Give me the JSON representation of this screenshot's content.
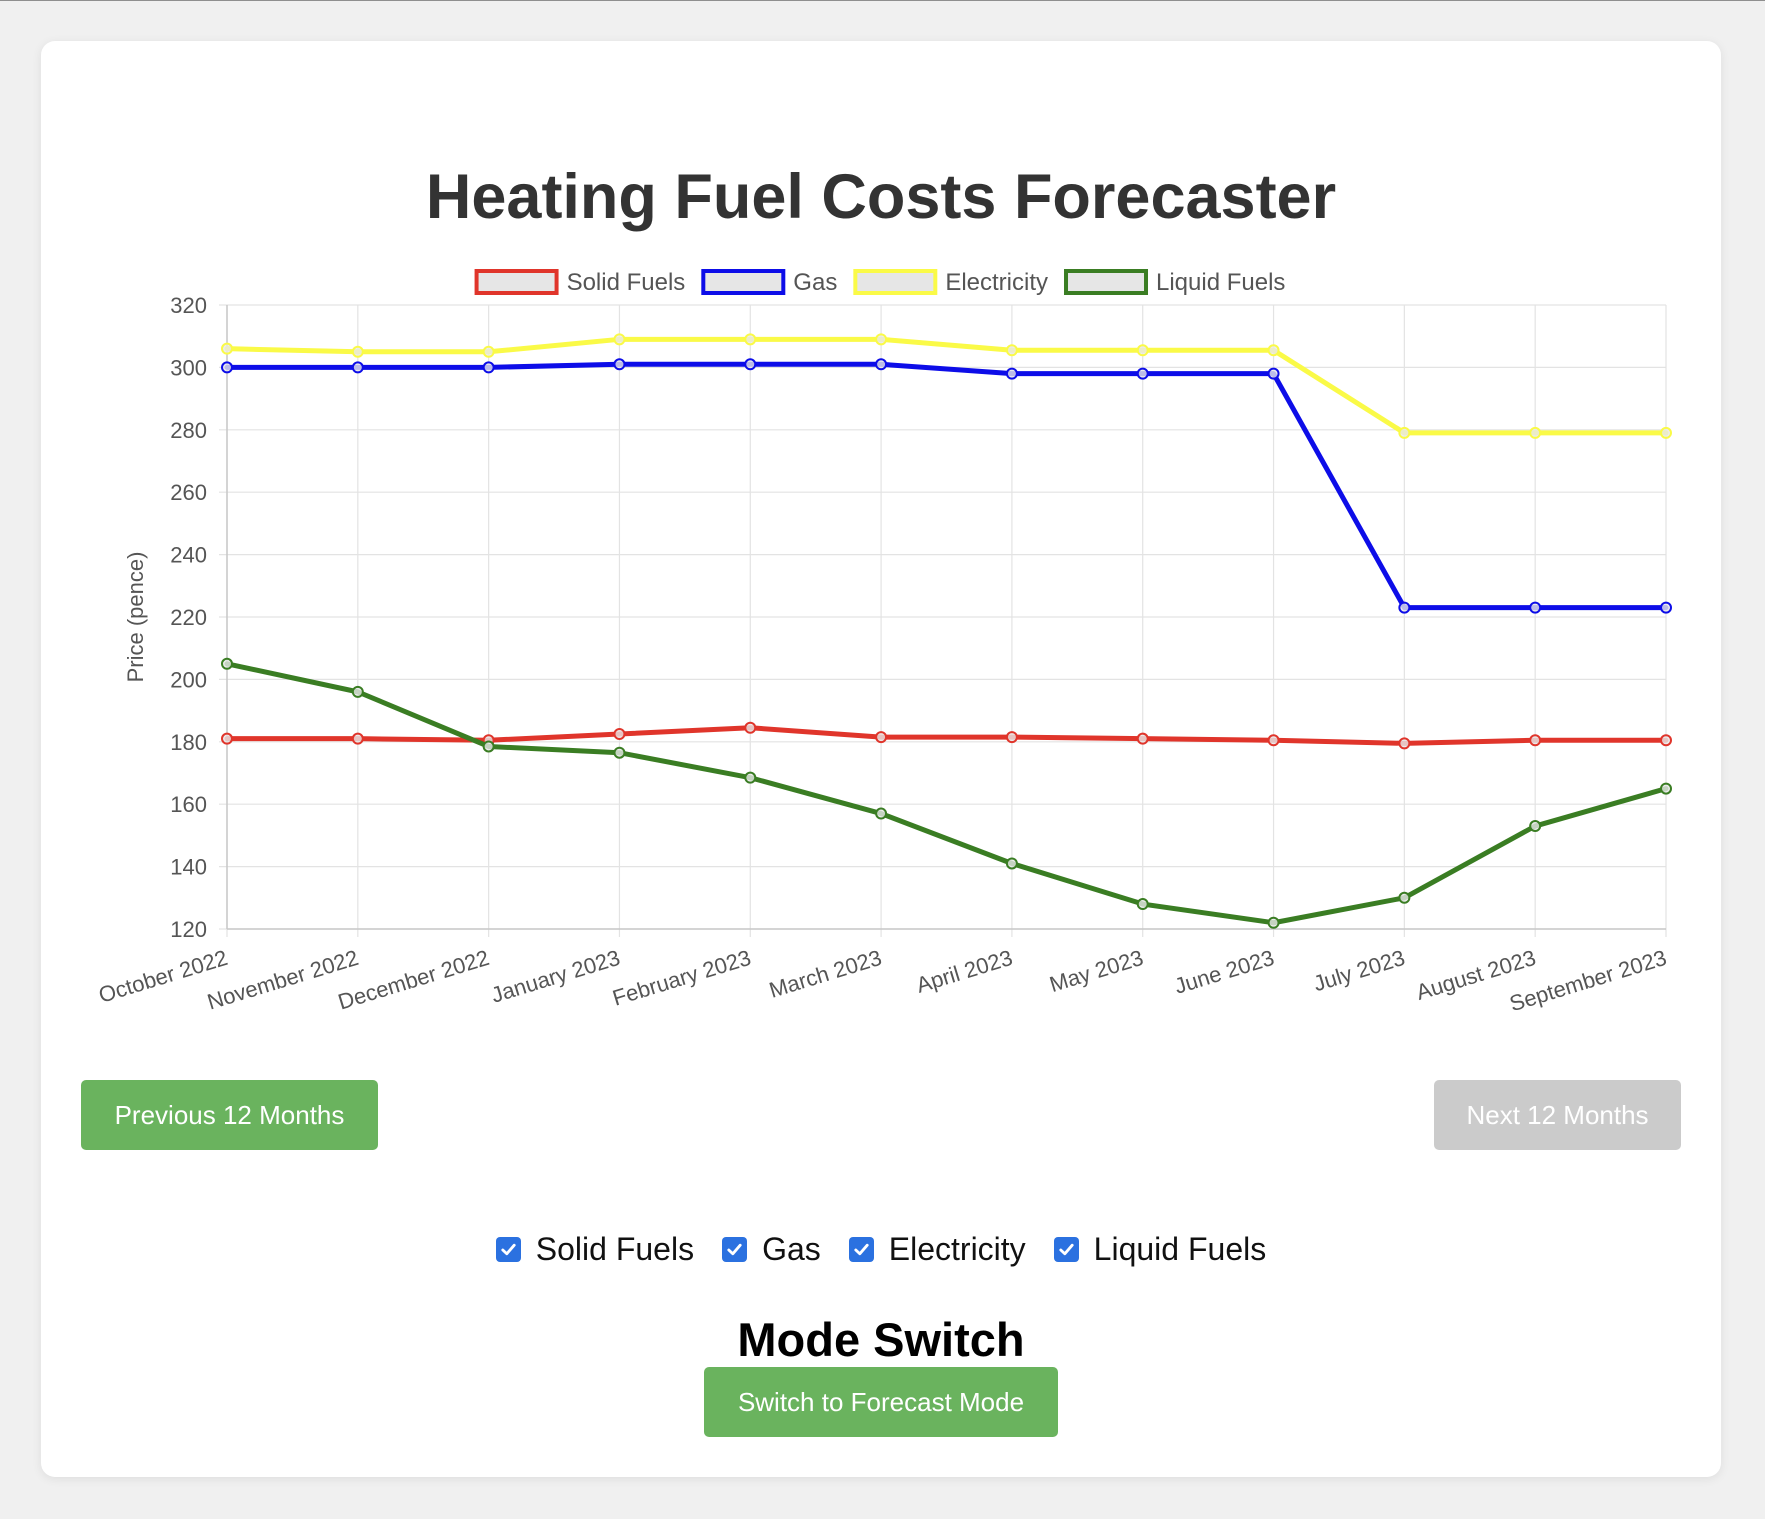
{
  "page": {
    "title": "Heating Fuel Costs Forecaster",
    "prev_button": "Previous 12 Months",
    "next_button": "Next 12 Months",
    "mode_title": "Mode Switch",
    "mode_button": "Switch to Forecast Mode",
    "toggles": [
      {
        "label": "Solid Fuels",
        "checked": true
      },
      {
        "label": "Gas",
        "checked": true
      },
      {
        "label": "Electricity",
        "checked": true
      },
      {
        "label": "Liquid Fuels",
        "checked": true
      }
    ],
    "colors": {
      "button_green": "#6ab35e",
      "button_disabled": "#cbcbcb",
      "checkbox_blue": "#2b71e0"
    }
  },
  "chart_data": {
    "type": "line",
    "title": "",
    "xlabel": "",
    "ylabel": "Price (pence)",
    "ylim": [
      120,
      320
    ],
    "yticks": [
      120,
      140,
      160,
      180,
      200,
      220,
      240,
      260,
      280,
      300,
      320
    ],
    "grid": true,
    "legend_position": "top",
    "categories": [
      "October 2022",
      "November 2022",
      "December 2022",
      "January 2023",
      "February 2023",
      "March 2023",
      "April 2023",
      "May 2023",
      "June 2023",
      "July 2023",
      "August 2023",
      "September 2023"
    ],
    "series": [
      {
        "name": "Solid Fuels",
        "color": "#e0352b",
        "values": [
          181,
          181,
          180.5,
          182.5,
          184.5,
          181.5,
          181.5,
          181,
          180.5,
          179.5,
          180.5,
          180.5
        ]
      },
      {
        "name": "Gas",
        "color": "#0d0de8",
        "values": [
          300,
          300,
          300,
          301,
          301,
          301,
          298,
          298,
          298,
          223,
          223,
          223
        ]
      },
      {
        "name": "Electricity",
        "color": "#fafa47",
        "values": [
          306,
          305,
          305,
          309,
          309,
          309,
          305.5,
          305.5,
          305.5,
          279,
          279,
          279
        ]
      },
      {
        "name": "Liquid Fuels",
        "color": "#3a7d23",
        "values": [
          205,
          196,
          178.5,
          176.5,
          168.5,
          157,
          141,
          128,
          122,
          130,
          153,
          165
        ]
      }
    ]
  }
}
